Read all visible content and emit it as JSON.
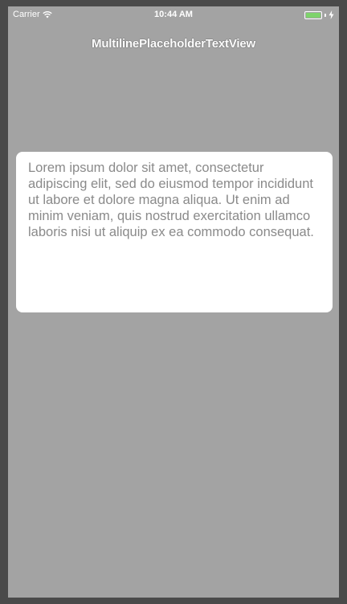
{
  "status_bar": {
    "carrier": "Carrier",
    "time": "10:44 AM",
    "battery_level": 1.0,
    "battery_color": "#7ed36b"
  },
  "nav": {
    "title": "MultilinePlaceholderTextView"
  },
  "text_view": {
    "placeholder": "Lorem ipsum dolor sit amet, consectetur adipiscing elit, sed do eiusmod tempor incididunt ut labore et dolore magna aliqua. Ut enim ad minim veniam, quis nostrud exercitation ullamco laboris nisi ut aliquip ex ea commodo consequat.",
    "value": ""
  },
  "colors": {
    "background": "#a3a3a3",
    "bezel": "#4a4a4a",
    "placeholder_text": "#8a8a8a"
  },
  "icons": [
    "wifi-icon",
    "battery-icon",
    "charging-icon"
  ]
}
